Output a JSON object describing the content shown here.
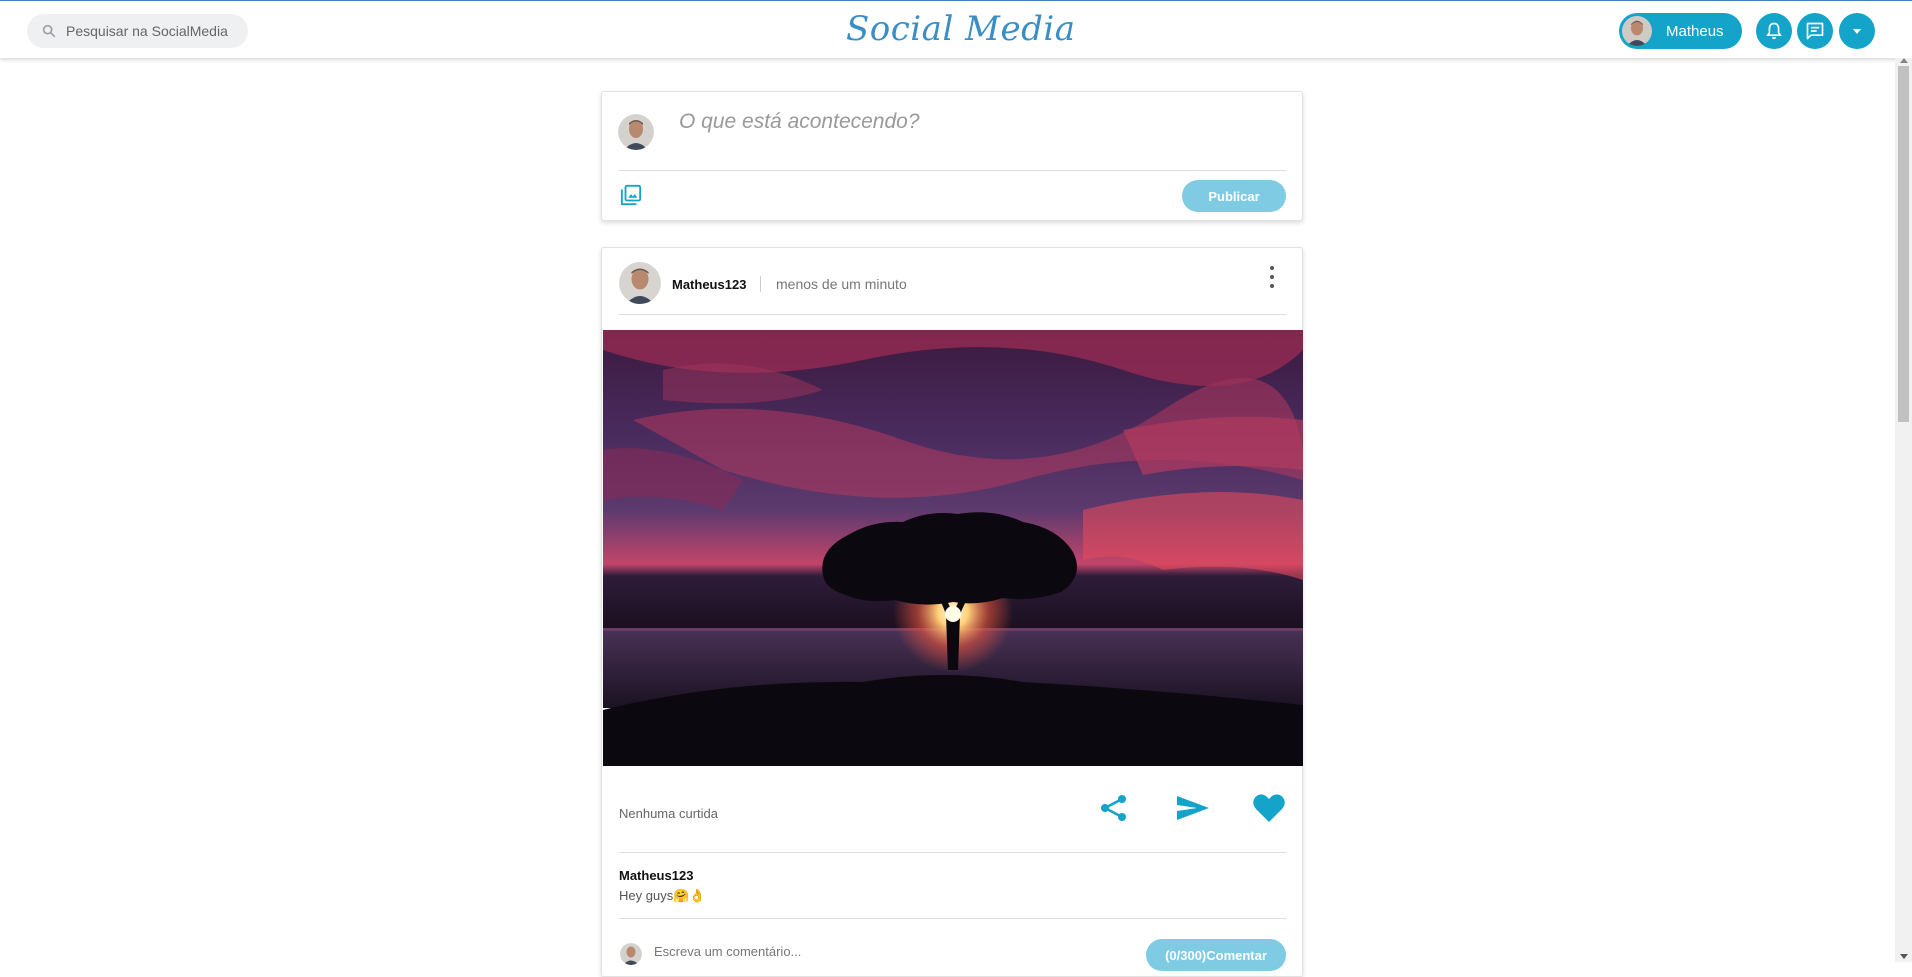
{
  "header": {
    "search_placeholder": "Pesquisar na SocialMedia",
    "brand": "Social Media",
    "user_name": "Matheus",
    "accent_color": "#14a3c9"
  },
  "composer": {
    "prompt": "O que está acontecendo?",
    "publish_label": "Publicar"
  },
  "post": {
    "author": "Matheus123",
    "time": "menos de um minuto",
    "likes_text": "Nenhuma curtida",
    "caption_author": "Matheus123",
    "caption_text": "Hey guys🤗👌",
    "comment_placeholder": "Escreva um comentário...",
    "comment_button": "(0/300)Comentar"
  },
  "icons": [
    "search-icon",
    "bell-icon",
    "chat-icon",
    "dropdown-caret-icon",
    "image-icon",
    "more-vert-icon",
    "share-icon",
    "send-icon",
    "heart-icon"
  ]
}
